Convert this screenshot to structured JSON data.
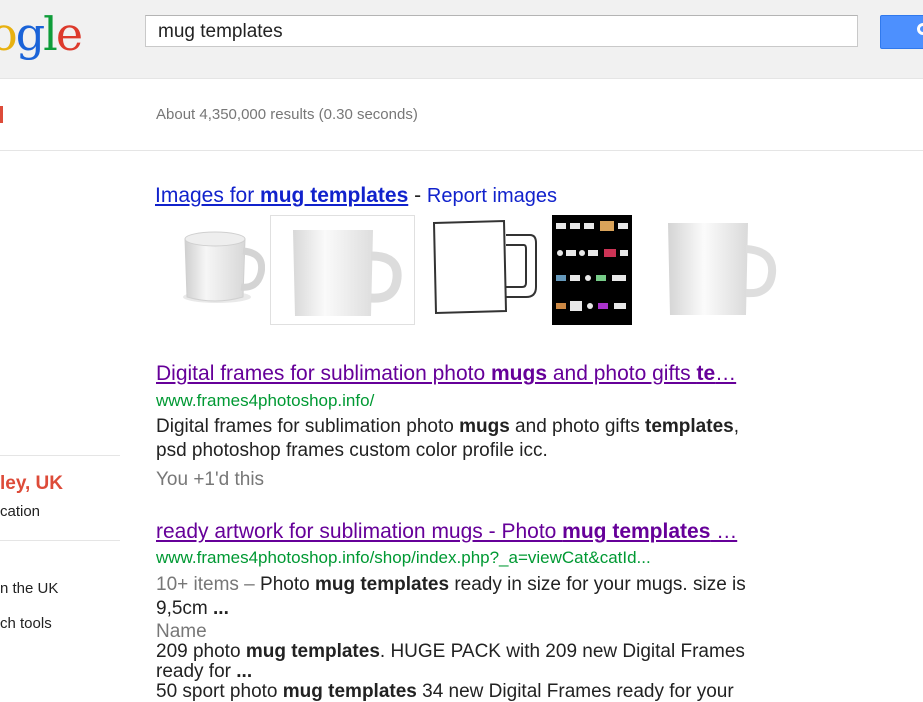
{
  "logo": {
    "text": "ogle",
    "letters": [
      "o",
      "g",
      "l",
      "e"
    ]
  },
  "search": {
    "value": "mug templates"
  },
  "result_stats": "About 4,350,000 results (0.30 seconds)",
  "sidebar": {
    "location_name": "ley, UK",
    "location_action": "cation",
    "links": [
      "n the UK",
      "ch tools"
    ]
  },
  "images_header": {
    "prefix": "Images for ",
    "query_bold": "mug templates",
    "separator": " - ",
    "report_label": "Report images"
  },
  "image_thumbs": [
    {
      "icon": "mug-photo"
    },
    {
      "icon": "mug-photo"
    },
    {
      "icon": "mug-outline"
    },
    {
      "icon": "template-collage"
    },
    {
      "icon": "mug-photo"
    }
  ],
  "results": [
    {
      "title_parts": [
        {
          "text": "Digital frames for sublimation photo ",
          "bold": false
        },
        {
          "text": "mugs",
          "bold": true
        },
        {
          "text": " and photo gifts ",
          "bold": false
        },
        {
          "text": "te",
          "bold": true
        },
        {
          "text": "…",
          "bold": false
        }
      ],
      "url": "www.frames4photoshop.info/",
      "snippet_lines": [
        [
          {
            "text": "Digital frames for sublimation photo ",
            "bold": false
          },
          {
            "text": "mugs",
            "bold": true
          },
          {
            "text": " and photo gifts ",
            "bold": false
          },
          {
            "text": "templates",
            "bold": true
          },
          {
            "text": ",",
            "bold": false
          }
        ],
        [
          {
            "text": "psd photoshop frames custom color profile icc.",
            "bold": false
          }
        ]
      ],
      "plus_one": "You +1'd this"
    },
    {
      "title_parts": [
        {
          "text": "ready artwork for sublimation mugs - Photo ",
          "bold": false
        },
        {
          "text": "mug templates",
          "bold": true
        },
        {
          "text": " …",
          "bold": false
        }
      ],
      "url": "www.frames4photoshop.info/shop/index.php?_a=viewCat&catId...",
      "items_line": {
        "count": "10+ items",
        "dash": " – ",
        "parts": [
          {
            "text": "Photo ",
            "bold": false
          },
          {
            "text": "mug templates",
            "bold": true
          },
          {
            "text": " ready in size for your mugs. size is",
            "bold": false
          }
        ]
      },
      "items_line2": [
        {
          "text": "9,5cm ",
          "bold": false
        },
        {
          "text": "...",
          "bold": true
        }
      ],
      "table_header": "Name",
      "table_rows": [
        [
          {
            "text": "209 photo ",
            "bold": false
          },
          {
            "text": "mug templates",
            "bold": true
          },
          {
            "text": ". HUGE PACK with 209 new Digital Frames",
            "bold": false
          }
        ],
        [
          {
            "text": "ready for ",
            "bold": false
          },
          {
            "text": "...",
            "bold": true
          }
        ],
        [
          {
            "text": "50 sport photo ",
            "bold": false
          },
          {
            "text": "mug templates",
            "bold": true
          },
          {
            "text": " 34 new Digital Frames ready for your",
            "bold": false
          }
        ]
      ]
    }
  ]
}
